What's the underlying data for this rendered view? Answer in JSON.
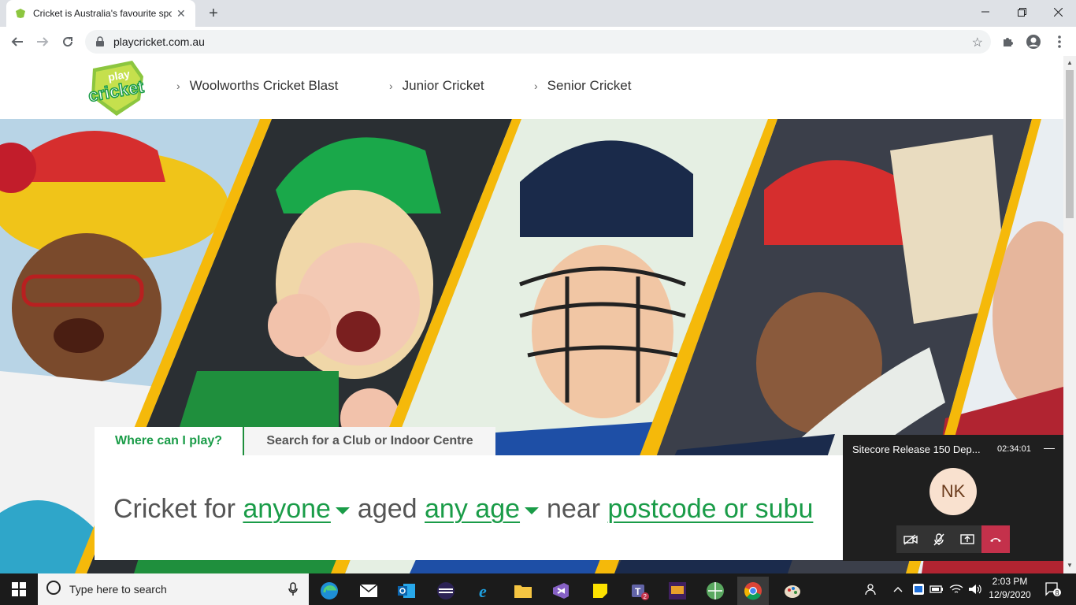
{
  "browser": {
    "tab_title": "Cricket is Australia's favourite spo",
    "url": "playcricket.com.au",
    "new_tab": "+",
    "close": "✕"
  },
  "site": {
    "logo_text_top": "play",
    "logo_text_main": "cricket",
    "nav": [
      {
        "label": "Woolworths Cricket Blast"
      },
      {
        "label": "Junior Cricket"
      },
      {
        "label": "Senior Cricket"
      }
    ]
  },
  "finder": {
    "tab_where": "Where can I play?",
    "tab_search": "Search for a Club or Indoor Centre",
    "sentence_1": "Cricket for",
    "link_who": "anyone",
    "sentence_2": "aged",
    "link_age": "any age",
    "sentence_3": "near",
    "link_location": "postcode or subu"
  },
  "teams": {
    "meeting_title": "Sitecore Release 150 Dep...",
    "time": "02:34:01",
    "minimize": "—",
    "initials": "NK"
  },
  "taskbar": {
    "search_placeholder": "Type here to search",
    "clock_time": "2:03 PM",
    "clock_date": "12/9/2020",
    "notification_count": "8",
    "teams_badge": "2"
  }
}
